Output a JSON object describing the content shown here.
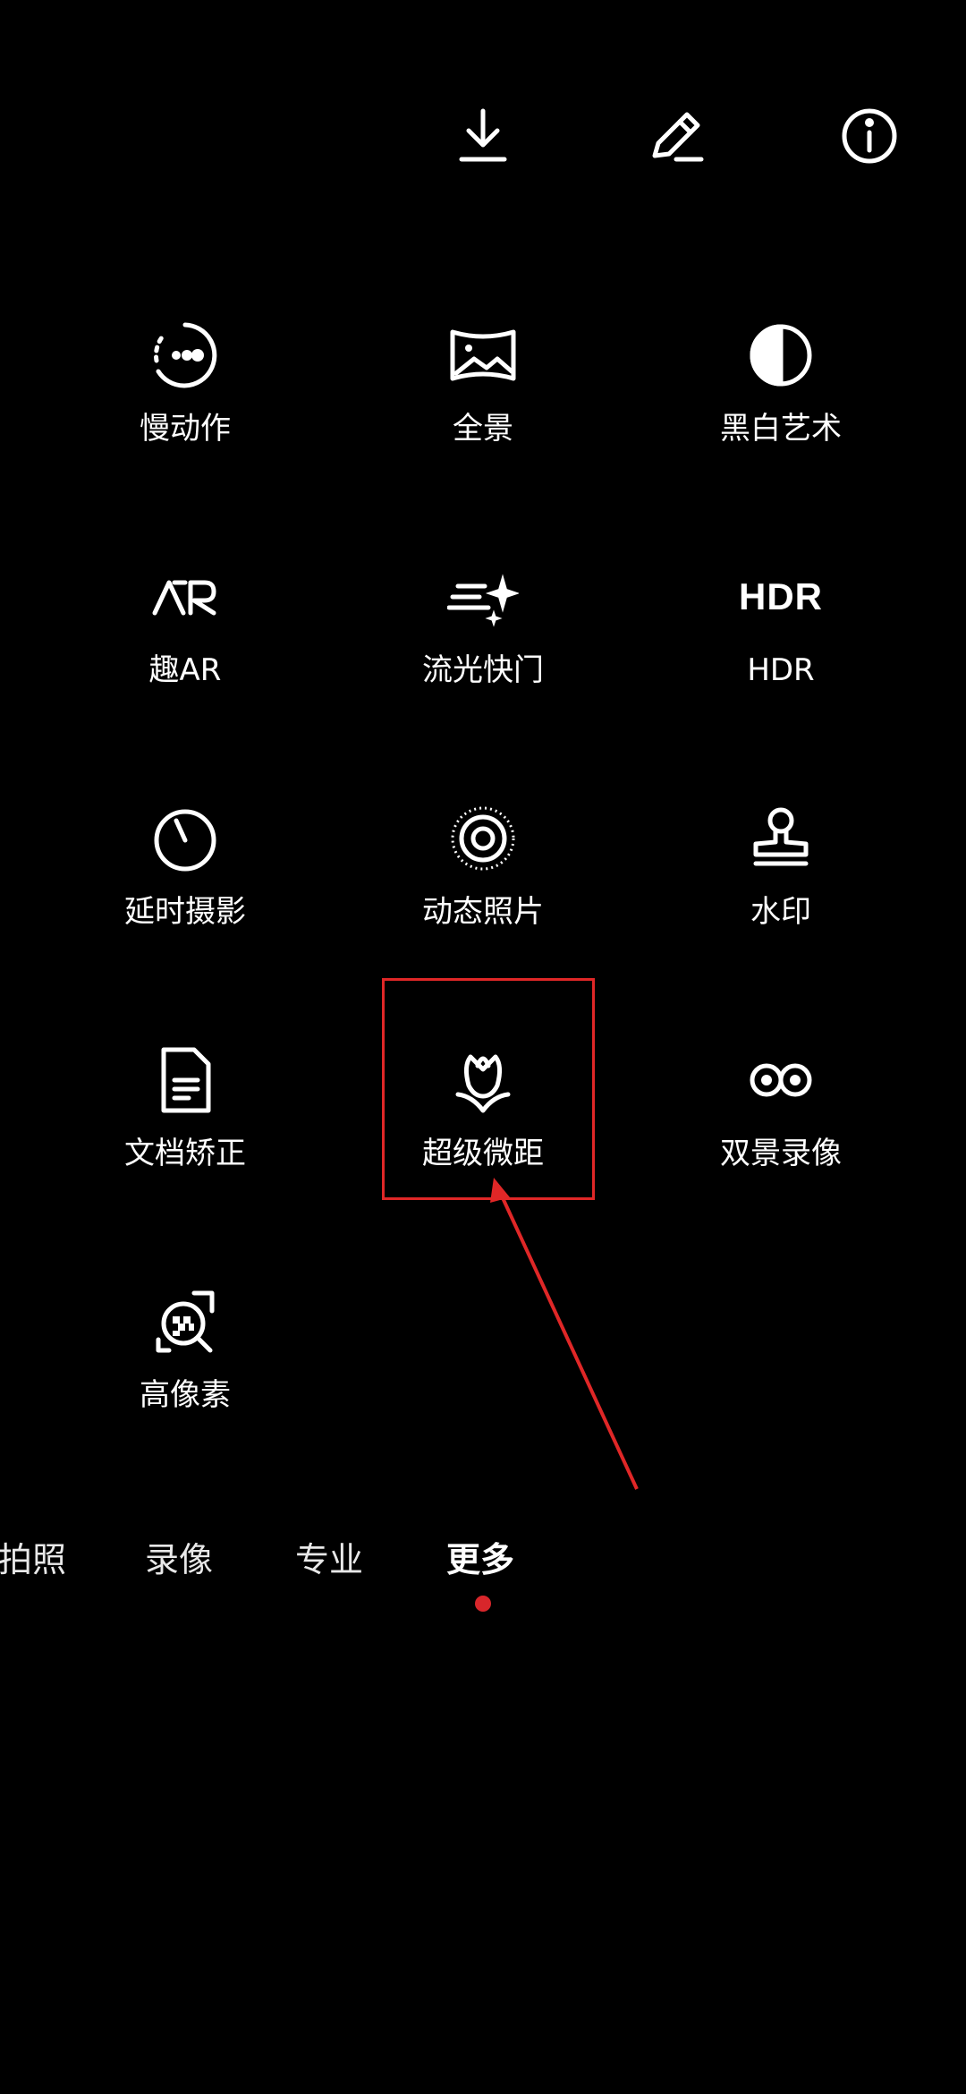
{
  "toolbar": {
    "icons": [
      "download-icon",
      "edit-icon",
      "info-icon"
    ]
  },
  "modes": [
    {
      "label": "慢动作",
      "icon": "slow-motion-icon"
    },
    {
      "label": "全景",
      "icon": "panorama-icon"
    },
    {
      "label": "黑白艺术",
      "icon": "monochrome-icon"
    },
    {
      "label": "趣AR",
      "icon": "ar-icon"
    },
    {
      "label": "流光快门",
      "icon": "light-painting-icon"
    },
    {
      "label": "HDR",
      "icon": "hdr-icon",
      "icon_text": "HDR"
    },
    {
      "label": "延时摄影",
      "icon": "timelapse-icon"
    },
    {
      "label": "动态照片",
      "icon": "moving-picture-icon"
    },
    {
      "label": "水印",
      "icon": "watermark-icon"
    },
    {
      "label": "文档矫正",
      "icon": "document-icon"
    },
    {
      "label": "超级微距",
      "icon": "super-macro-icon"
    },
    {
      "label": "双景录像",
      "icon": "dual-view-icon"
    },
    {
      "label": "高像素",
      "icon": "high-resolution-icon"
    }
  ],
  "tabs": [
    {
      "label": "拍照",
      "active": false
    },
    {
      "label": "录像",
      "active": false
    },
    {
      "label": "专业",
      "active": false
    },
    {
      "label": "更多",
      "active": true
    }
  ],
  "colors": {
    "background": "#000000",
    "highlight": "#e02727",
    "active_dot": "#d8262b"
  }
}
